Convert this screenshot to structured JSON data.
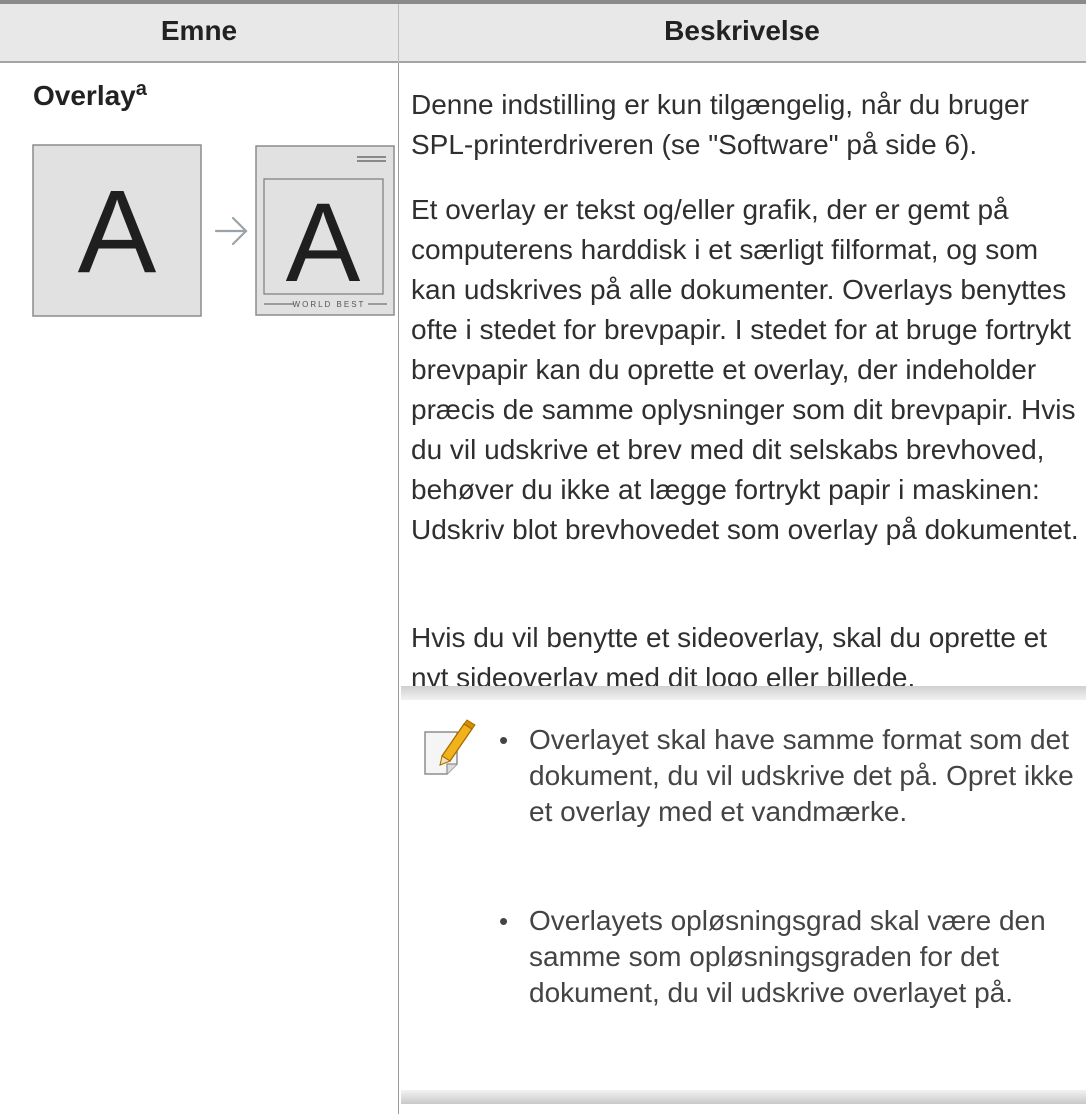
{
  "table": {
    "headers": {
      "emne": "Emne",
      "beskrivelse": "Beskrivelse"
    },
    "row": {
      "topic": "Overlay",
      "topic_footnote_mark": "a",
      "illustration": {
        "letter": "A",
        "banner_text": "WORLD BEST",
        "arrow_icon": "arrow-right-icon"
      },
      "paragraphs": [
        "Denne indstilling er kun tilgængelig, når du bruger SPL-printerdriveren (se \"Software\" på side 6).",
        "Et overlay er tekst og/eller grafik, der er gemt på computerens harddisk i et særligt filformat, og som kan udskrives på alle dokumenter. Overlays benyttes ofte i stedet for brevpapir. I stedet for at bruge fortrykt brevpapir kan du oprette et overlay, der indeholder præcis de samme oplysninger som dit brevpapir. Hvis du vil udskrive et brev med dit selskabs brevhoved, behøver du ikke at lægge fortrykt papir i maskinen: Udskriv blot brevhovedet som overlay på dokumentet.",
        "Hvis du vil benytte et sideoverlay, skal du oprette et nyt sideoverlay med dit logo eller billede."
      ],
      "note": {
        "icon": "note-pencil-icon",
        "bullets": [
          "Overlayet skal have samme format som det dokument, du vil udskrive det på. Opret ikke et overlay med et vandmærke.",
          "Overlayets opløsningsgrad skal være den samme som opløsningsgraden for det dokument, du vil udskrive overlayet på."
        ]
      }
    }
  },
  "colors": {
    "header_bg": "#e8e8e8",
    "text": "#2f2f2f",
    "note_pencil": "#f2b21b"
  }
}
